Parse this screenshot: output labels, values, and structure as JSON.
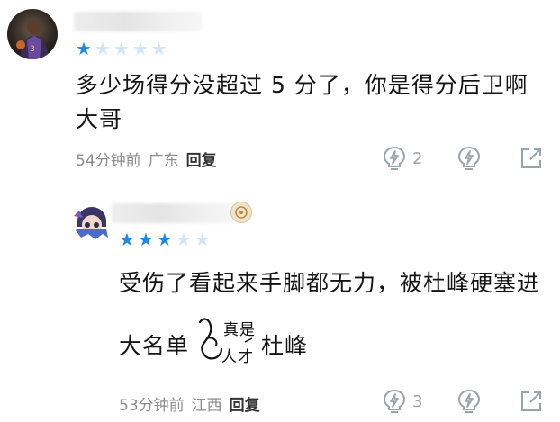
{
  "comments": [
    {
      "avatar_icon": "player-avatar",
      "username": "",
      "rating": 1,
      "rating_max": 5,
      "text_line1": "多少场得分没超过 5 分了，你是得分后卫啊",
      "text_line2": "大哥",
      "time": "54分钟前",
      "location": "广东",
      "reply_label": "回复",
      "like_count": "2",
      "icons": {
        "like": "lightning-bulb-icon",
        "dislike": "lightning-bulb-icon",
        "share": "share-icon"
      }
    },
    {
      "avatar_icon": "cartoon-avatar",
      "username": "",
      "rating": 3,
      "rating_max": 5,
      "text_line1": "受伤了看起来手脚都无力，被杜峰硬塞进",
      "text_line2_before": "大名单",
      "meme_text": "真是人才",
      "text_line2_after": "杜峰",
      "time": "53分钟前",
      "location": "江西",
      "reply_label": "回复",
      "like_count": "3",
      "icons": {
        "like": "lightning-bulb-icon",
        "dislike": "lightning-bulb-icon",
        "share": "share-icon"
      }
    }
  ],
  "colors": {
    "star_active": "#1e88e5",
    "star_inactive": "#cfe6fa",
    "meta": "#8c8c8c",
    "icon": "#9aa4ad"
  }
}
